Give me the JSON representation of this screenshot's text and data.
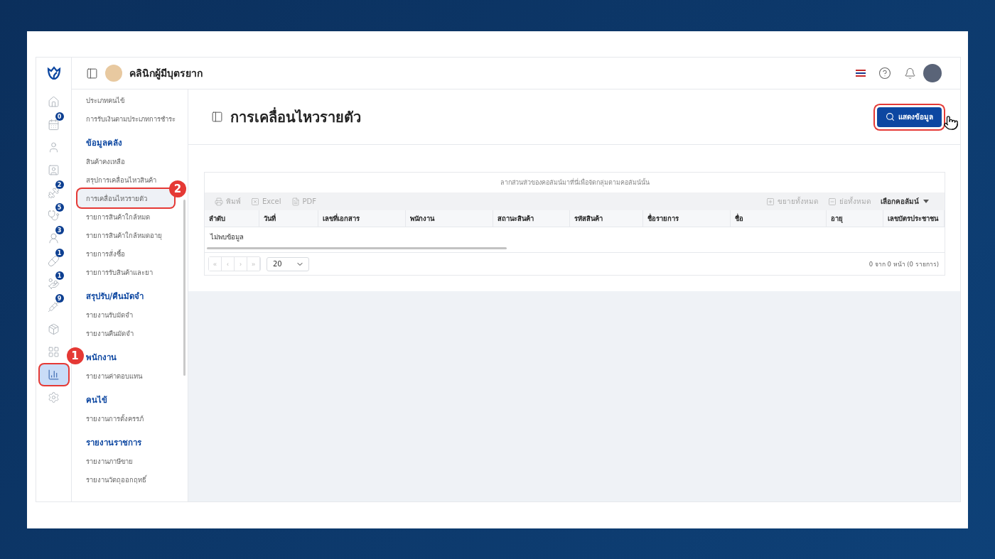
{
  "header": {
    "clinic_name": "คลินิกผู้มีบุตรยาก"
  },
  "rail": [
    {
      "selected": false
    },
    {
      "badge": "0",
      "selected": false
    },
    {
      "selected": false
    },
    {
      "selected": false
    },
    {
      "badge": "2",
      "selected": false
    },
    {
      "badge": "5",
      "selected": false
    },
    {
      "badge": "3",
      "selected": false
    },
    {
      "badge": "1",
      "selected": false
    },
    {
      "badge": "1",
      "selected": false
    },
    {
      "badge": "9",
      "selected": false
    },
    {
      "selected": false
    },
    {
      "selected": false
    },
    {
      "selected": true,
      "callout": "1"
    },
    {
      "selected": false
    }
  ],
  "sidebar": [
    {
      "kind": "item",
      "label": "ประเภทคนไข้",
      "selected": false
    },
    {
      "kind": "item",
      "label": "การรับเงินตามประเภทการชำระ",
      "selected": false
    },
    {
      "kind": "heading",
      "label": "ข้อมูลคลัง"
    },
    {
      "kind": "item",
      "label": "สินค้าคงเหลือ",
      "selected": false
    },
    {
      "kind": "item",
      "label": "สรุปการเคลื่อนไหวสินค้า",
      "selected": false
    },
    {
      "kind": "item",
      "label": "การเคลื่อนไหวรายตัว",
      "selected": true,
      "callout": "2"
    },
    {
      "kind": "item",
      "label": "รายการสินค้าใกล้หมด",
      "selected": false
    },
    {
      "kind": "item",
      "label": "รายการสินค้าใกล้หมดอายุ",
      "selected": false
    },
    {
      "kind": "item",
      "label": "รายการสั่งซื้อ",
      "selected": false
    },
    {
      "kind": "item",
      "label": "รายการรับสินค้าและยา",
      "selected": false
    },
    {
      "kind": "heading",
      "label": "สรุปรับ/คืนมัดจำ"
    },
    {
      "kind": "item",
      "label": "รายงานรับมัดจำ",
      "selected": false
    },
    {
      "kind": "item",
      "label": "รายงานคืนมัดจำ",
      "selected": false
    },
    {
      "kind": "heading",
      "label": "พนักงาน"
    },
    {
      "kind": "item",
      "label": "รายงานค่าตอบแทน",
      "selected": false
    },
    {
      "kind": "heading",
      "label": "คนไข้"
    },
    {
      "kind": "item",
      "label": "รายงานการตั้งครรภ์",
      "selected": false
    },
    {
      "kind": "heading",
      "label": "รายงานราชการ"
    },
    {
      "kind": "item",
      "label": "รายงานภาษีขาย",
      "selected": false
    },
    {
      "kind": "item",
      "label": "รายงานวัตถุออกฤทธิ์",
      "selected": false
    }
  ],
  "page": {
    "title": "การเคลื่อนไหวรายตัว",
    "show_button": "แสดงข้อมูล"
  },
  "table": {
    "group_hint": "ลากส่วนหัวของคอลัมน์มาที่นี่เพื่อจัดกลุ่มตามคอลัมน์นั้น",
    "toolbar_left": [
      "พิมพ์",
      "Excel",
      "PDF"
    ],
    "expand_all": "ขยายทั้งหมด",
    "collapse_all": "ย่อทั้งหมด",
    "choose_columns": "เลือกคอลัมน์",
    "columns": [
      "ลำดับ",
      "วันที่",
      "เลขที่เอกสาร",
      "พนักงาน",
      "สถานะสินค้า",
      "รหัสสินค้า",
      "ชื่อรายการ",
      "ชื่อ",
      "อายุ",
      "เลขบัตรประชาชน"
    ],
    "empty": "ไม่พบข้อมูล",
    "pager": [
      "«",
      "‹",
      "›",
      "»"
    ],
    "page_size": "20",
    "summary": "0 จาก 0 หน้า (0 รายการ)"
  }
}
